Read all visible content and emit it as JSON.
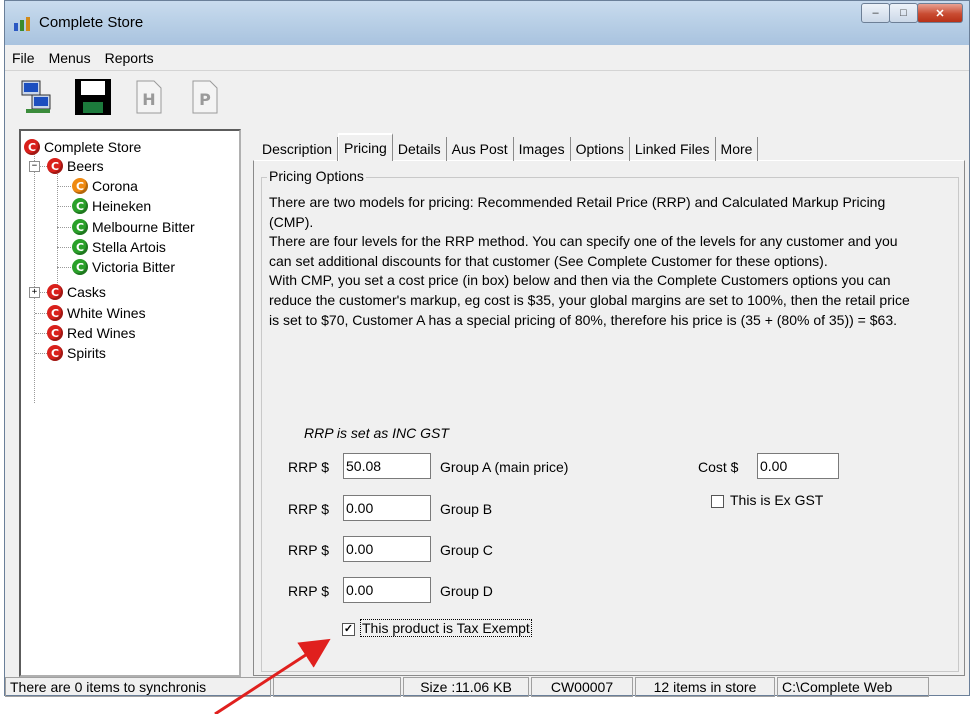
{
  "window": {
    "title": "Complete Store",
    "controls": [
      "minimize",
      "maximize",
      "close"
    ]
  },
  "menubar": {
    "items": [
      "File",
      "Menus",
      "Reports"
    ]
  },
  "toolbar": {
    "buttons": [
      {
        "name": "sync-icon",
        "label": ""
      },
      {
        "name": "save-icon",
        "label": ""
      },
      {
        "name": "h-icon",
        "label": "H"
      },
      {
        "name": "p-icon",
        "label": "P"
      }
    ]
  },
  "tree": {
    "root": "Complete Store",
    "beers": "Beers",
    "corona": "Corona",
    "heineken": "Heineken",
    "melbourne": "Melbourne Bitter",
    "stella": "Stella Artois",
    "victoria": "Victoria Bitter",
    "casks": "Casks",
    "white_wines": "White Wines",
    "red_wines": "Red Wines",
    "spirits": "Spirits",
    "icon_letter": "C"
  },
  "tabs": [
    "Description",
    "Pricing",
    "Details",
    "Aus Post",
    "Images",
    "Options",
    "Linked Files",
    "More"
  ],
  "active_tab": "Pricing",
  "pricing": {
    "group_label": "Pricing Options",
    "paragraph": "There are two models for pricing: Recommended Retail Price (RRP) and Calculated Markup Pricing (CMP).\nThere are four levels for the RRP method. You can specify one of the levels for any customer and you can set additional discounts for that customer (See Complete Customer for these options).\nWith CMP, you set a cost price (in box) below and then via the Complete Customers options you can reduce the customer's markup, eg cost is $35, your global margins are set to 100%, then the retail price is set to $70, Customer A has a special pricing of 80%, therefore his price is (35 + (80% of 35)) = $63.",
    "rrp_note": "RRP is set as INC GST",
    "rrp_label": "RRP $",
    "rows": [
      {
        "value": "50.08",
        "group": "Group A (main price)"
      },
      {
        "value": "0.00",
        "group": "Group B"
      },
      {
        "value": "0.00",
        "group": "Group C"
      },
      {
        "value": "0.00",
        "group": "Group D"
      }
    ],
    "cost_label": "Cost $",
    "cost_value": "0.00",
    "ex_gst_label": "This is Ex GST",
    "ex_gst_checked": false,
    "tax_exempt_label": "This product is Tax Exempt",
    "tax_exempt_checked": true
  },
  "statusbar": {
    "sync": "There are 0 items to synchronis",
    "blank": "",
    "size": "Size :11.06 KB",
    "code": "CW00007",
    "items": "12 items in store",
    "path": "C:\\Complete Web"
  },
  "colors": {
    "annotation_arrow": "#e0201e",
    "icon_red": "#d9201b",
    "icon_green": "#2aa02a",
    "icon_orange": "#ef8a12"
  }
}
